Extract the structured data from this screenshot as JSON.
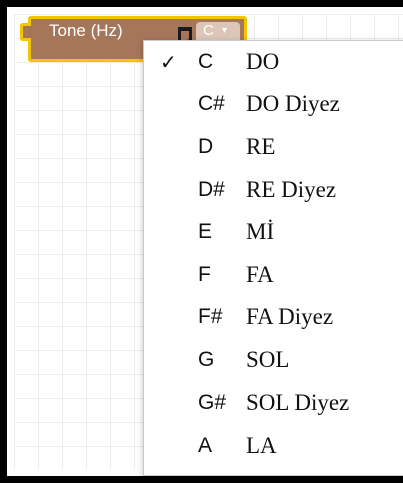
{
  "block": {
    "label": "Tone (Hz)",
    "selected_value": "C",
    "dropdown_arrow": "▾",
    "icon": "music-note-icon"
  },
  "menu": {
    "check_mark": "✓",
    "items": [
      {
        "code": "C",
        "name": "DO",
        "checked": true
      },
      {
        "code": "C#",
        "name": "DO Diyez",
        "checked": false
      },
      {
        "code": "D",
        "name": "RE",
        "checked": false
      },
      {
        "code": "D#",
        "name": "RE Diyez",
        "checked": false
      },
      {
        "code": "E",
        "name": "Mİ",
        "checked": false
      },
      {
        "code": "F",
        "name": "FA",
        "checked": false
      },
      {
        "code": "F#",
        "name": "FA Diyez",
        "checked": false
      },
      {
        "code": "G",
        "name": "SOL",
        "checked": false
      },
      {
        "code": "G#",
        "name": "SOL Diyez",
        "checked": false
      },
      {
        "code": "A",
        "name": "LA",
        "checked": false
      }
    ]
  },
  "colors": {
    "block_fill": "#a5765a",
    "block_highlight": "#f3c400",
    "dropdown_fill": "#dcc6b8"
  }
}
